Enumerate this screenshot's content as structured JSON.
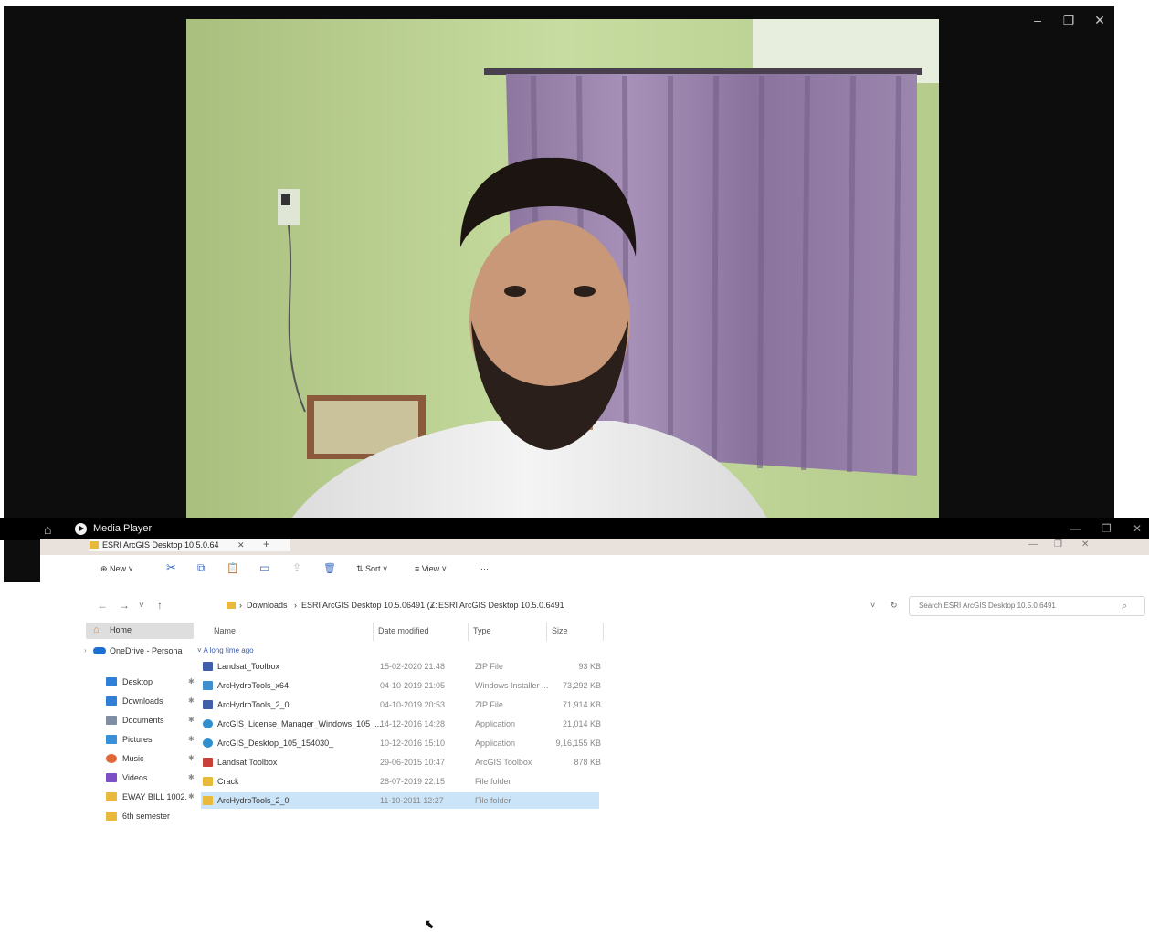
{
  "media_player": {
    "title": "Media Player",
    "window_controls": {
      "minimize": "–",
      "maximize": "❐",
      "close": "✕"
    }
  },
  "explorer": {
    "tab": {
      "title": "ESRI ArcGIS Desktop 10.5.0.64",
      "close": "✕",
      "new_tab": "+"
    },
    "window_controls": {
      "minimize": "—",
      "maximize": "❐",
      "close": "✕"
    },
    "command_bar": {
      "new": "⊕ New ˅",
      "cut": "✂",
      "copy": "⧉",
      "paste": "📋",
      "rename": "▭",
      "share": "⇪",
      "delete": "🗑",
      "sort": "⇅ Sort ˅",
      "view": "≡ View ˅",
      "more": "···"
    },
    "nav_buttons": {
      "back": "←",
      "forward": "→",
      "recent": "˅",
      "up": "↑"
    },
    "address": {
      "crumbs": [
        "Downloads",
        "ESRI ArcGIS Desktop 10.5.06491 (Z:",
        "ESRI ArcGIS Desktop 10.5.0.6491"
      ],
      "separator": "›",
      "dropdown": "˅",
      "refresh": "↻"
    },
    "search": {
      "placeholder": "Search ESRI ArcGIS Desktop 10.5.0.6491",
      "icon": "search-icon"
    },
    "nav_pane": {
      "home": "Home",
      "onedrive": "OneDrive - Persona",
      "quick_access": [
        {
          "label": "Desktop",
          "icon": "desktop-icon",
          "color": "#2f7fd6"
        },
        {
          "label": "Downloads",
          "icon": "download-icon",
          "color": "#2f7fd6"
        },
        {
          "label": "Documents",
          "icon": "document-icon",
          "color": "#7f8ea3"
        },
        {
          "label": "Pictures",
          "icon": "pictures-icon",
          "color": "#3a8fd9"
        },
        {
          "label": "Music",
          "icon": "music-icon",
          "color": "#e0673a"
        },
        {
          "label": "Videos",
          "icon": "video-icon",
          "color": "#7c4fc4"
        },
        {
          "label": "EWAY BILL 1002.",
          "icon": "folder-icon",
          "color": "#e9b93b"
        },
        {
          "label": "6th semester",
          "icon": "folder-icon",
          "color": "#e9b93b"
        }
      ],
      "pin_glyph": "✱"
    },
    "columns": {
      "name": "Name",
      "date": "Date modified",
      "type": "Type",
      "size": "Size"
    },
    "group_header": "˅ A long time ago",
    "files": [
      {
        "name": "Landsat_Toolbox",
        "date": "15-02-2020 21:48",
        "type": "ZIP File",
        "size": "93 KB",
        "icon": "zip-icon",
        "color": "#3f5fa8"
      },
      {
        "name": "ArcHydroTools_x64",
        "date": "04-10-2019 21:05",
        "type": "Windows Installer ...",
        "size": "73,292 KB",
        "icon": "installer-icon",
        "color": "#3f8fcf"
      },
      {
        "name": "ArcHydroTools_2_0",
        "date": "04-10-2019 20:53",
        "type": "ZIP File",
        "size": "71,914 KB",
        "icon": "zip-icon",
        "color": "#3f5fa8"
      },
      {
        "name": "ArcGIS_License_Manager_Windows_105_...",
        "date": "14-12-2016 14:28",
        "type": "Application",
        "size": "21,014 KB",
        "icon": "arcgis-icon",
        "color": "#2f8fcf"
      },
      {
        "name": "ArcGIS_Desktop_105_154030_",
        "date": "10-12-2016 15:10",
        "type": "Application",
        "size": "9,16,155 KB",
        "icon": "arcgis-icon",
        "color": "#2f8fcf"
      },
      {
        "name": "Landsat Toolbox",
        "date": "29-06-2015 10:47",
        "type": "ArcGIS Toolbox",
        "size": "878 KB",
        "icon": "toolbox-icon",
        "color": "#c9403a"
      },
      {
        "name": "Crack",
        "date": "28-07-2019 22:15",
        "type": "File folder",
        "size": "",
        "icon": "folder-icon",
        "color": "#e9b93b"
      },
      {
        "name": "ArcHydroTools_2_0",
        "date": "11-10-2011 12:27",
        "type": "File folder",
        "size": "",
        "icon": "folder-icon",
        "color": "#e9b93b",
        "selected": true
      }
    ]
  }
}
